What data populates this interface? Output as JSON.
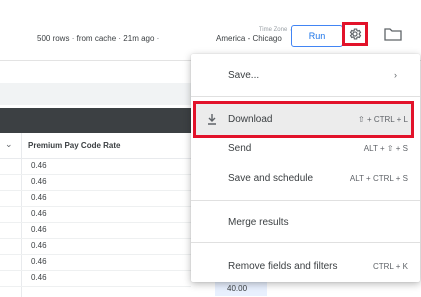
{
  "toolbar": {
    "rows_text": "500 rows",
    "source_text": "from cache",
    "age_text": "21m ago",
    "timezone_label": "Time Zone",
    "timezone_value": "America - Chicago",
    "run_label": "Run"
  },
  "table": {
    "column_header": "Premium Pay Code Rate",
    "values": [
      "0.46",
      "0.46",
      "0.46",
      "0.46",
      "0.46",
      "0.46",
      "0.46",
      "0.46"
    ],
    "peek_value": "40.00"
  },
  "menu": {
    "items": [
      {
        "label": "Save...",
        "shortcut": ""
      },
      {
        "label": "Download",
        "shortcut": "⇧ + CTRL + L"
      },
      {
        "label": "Send",
        "shortcut": "ALT + ⇧ + S"
      },
      {
        "label": "Save and schedule",
        "shortcut": "ALT + CTRL + S"
      },
      {
        "label": "Merge results",
        "shortcut": ""
      },
      {
        "label": "Remove fields and filters",
        "shortcut": "CTRL + K"
      }
    ]
  },
  "icons": [
    "gear-icon",
    "folder-icon",
    "download-icon",
    "chevron-right-icon",
    "chevron-down-icon"
  ],
  "colors": {
    "highlight_border": "#e2122a",
    "run_button": "#1a73e8",
    "dark_band": "#3c4043"
  }
}
